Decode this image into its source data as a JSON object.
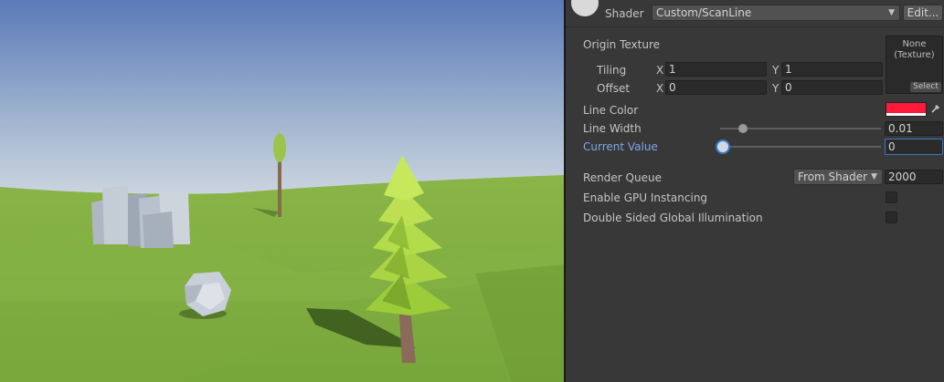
{
  "header": {
    "shader_label": "Shader",
    "shader_value": "Custom/ScanLine",
    "edit_button": "Edit..."
  },
  "texture": {
    "label": "Origin Texture",
    "tiling_label": "Tiling",
    "offset_label": "Offset",
    "x_label": "X",
    "y_label": "Y",
    "tiling_x": "1",
    "tiling_y": "1",
    "offset_x": "0",
    "offset_y": "0",
    "preview_text": "None\n(Texture)",
    "select_button": "Select"
  },
  "properties": {
    "line_color_label": "Line Color",
    "line_color": "#ff1a3c",
    "line_width_label": "Line Width",
    "line_width_value": "0.01",
    "line_width_fraction": 0.14,
    "current_value_label": "Current Value",
    "current_value": "0",
    "current_value_fraction": 0.0
  },
  "settings": {
    "render_queue_label": "Render Queue",
    "render_queue_mode": "From Shader",
    "render_queue_value": "2000",
    "gpu_instancing_label": "Enable GPU Instancing",
    "gpu_instancing_checked": false,
    "double_sided_gi_label": "Double Sided Global Illumination",
    "double_sided_gi_checked": false
  },
  "colors": {
    "accent": "#7ca7e8",
    "panel_bg": "#383838"
  }
}
